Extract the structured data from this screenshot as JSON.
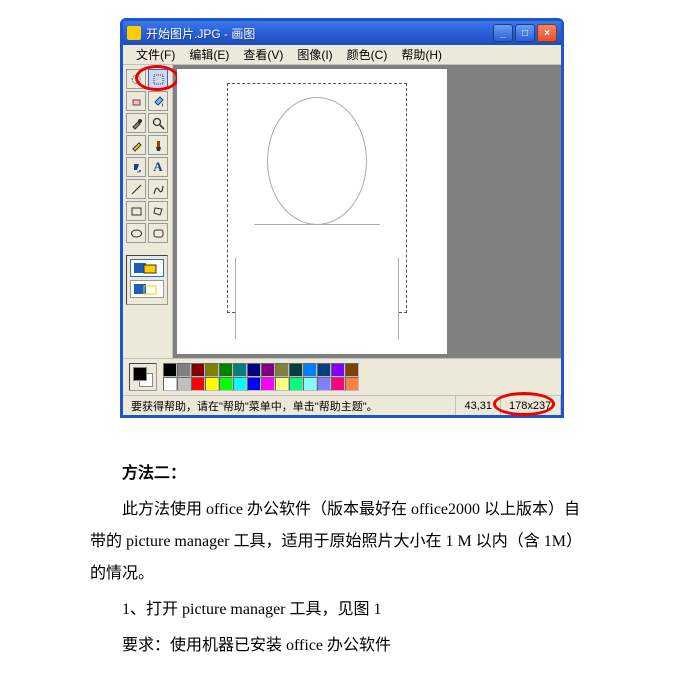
{
  "window": {
    "title": "开始图片.JPG - 画图",
    "controls": {
      "minimize": "_",
      "maximize": "□",
      "close": "×"
    }
  },
  "menu": {
    "file": "文件(F)",
    "edit": "编辑(E)",
    "view": "查看(V)",
    "image": "图像(I)",
    "color": "颜色(C)",
    "help": "帮助(H)"
  },
  "tools": {
    "freeform_select": "freeform-select",
    "rect_select": "rect-select",
    "eraser": "eraser",
    "fill": "fill",
    "picker": "picker",
    "magnify": "magnify",
    "pencil": "pencil",
    "brush": "brush",
    "airbrush": "airbrush",
    "text": "text",
    "line": "line",
    "curve": "curve",
    "rect": "rect",
    "polygon": "polygon",
    "ellipse": "ellipse",
    "roundrect": "roundrect"
  },
  "palette_top": [
    "#000000",
    "#808080",
    "#800000",
    "#808000",
    "#008000",
    "#008080",
    "#000080",
    "#800080",
    "#808040",
    "#004040",
    "#0080ff",
    "#004080",
    "#8000ff",
    "#804000"
  ],
  "palette_bottom": [
    "#ffffff",
    "#c0c0c0",
    "#ff0000",
    "#ffff00",
    "#00ff00",
    "#00ffff",
    "#0000ff",
    "#ff00ff",
    "#ffff80",
    "#00ff80",
    "#80ffff",
    "#8080ff",
    "#ff0080",
    "#ff8040"
  ],
  "status": {
    "help_text": "要获得帮助，请在\"帮助\"菜单中，单击\"帮助主题\"。",
    "coords": "43,31",
    "dimensions": "178x237"
  },
  "article": {
    "heading": "方法二：",
    "p1": "此方法使用 office 办公软件（版本最好在 office2000 以上版本）自带的 picture manager 工具，适用于原始照片大小在 1 M 以内（含 1M）的情况。",
    "p2": "1、打开 picture manager 工具，见图 1",
    "p3": "要求：使用机器已安装 office 办公软件"
  }
}
